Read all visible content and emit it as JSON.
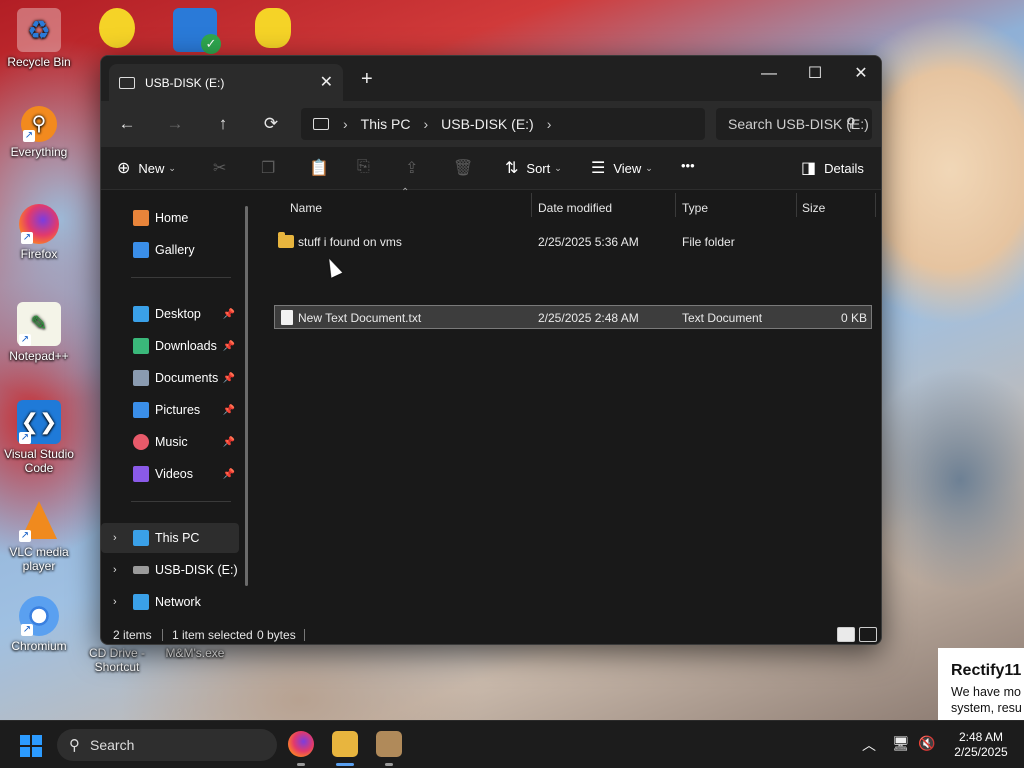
{
  "desktop": {
    "icons": [
      {
        "label": "Recycle Bin",
        "icon": "recycle-bin-icon"
      },
      {
        "label": "Everything",
        "icon": "everything-search-icon"
      },
      {
        "label": "Firefox",
        "icon": "firefox-icon"
      },
      {
        "label": "Notepad++",
        "icon": "notepadpp-icon"
      },
      {
        "label": "Visual Studio Code",
        "icon": "vscode-icon"
      },
      {
        "label": "VLC media player",
        "icon": "vlc-icon"
      },
      {
        "label": "Chromium",
        "icon": "chromium-icon"
      },
      {
        "label": "CD Drive - Shortcut",
        "icon": "cd-drive-icon"
      },
      {
        "label": "M&M's.exe",
        "icon": "exe-icon"
      }
    ]
  },
  "window": {
    "tab_title": "USB-DISK (E:)",
    "new_tab": "+",
    "controls": {
      "minimize": "—",
      "maximize": "☐",
      "close": "✕"
    }
  },
  "nav": {
    "back": "←",
    "forward": "→",
    "up": "↑",
    "refresh": "⟳",
    "breadcrumb": [
      "This PC",
      "USB-DISK (E:)"
    ],
    "search_placeholder": "Search USB-DISK (E:)"
  },
  "toolbar": {
    "new": "New",
    "sort": "Sort",
    "view": "View",
    "more": "•••",
    "details": "Details"
  },
  "sidebar": {
    "top": [
      {
        "label": "Home",
        "color": "#e8843a"
      },
      {
        "label": "Gallery",
        "color": "#3a8ee8"
      }
    ],
    "pinned": [
      {
        "label": "Desktop",
        "color": "#3aa0e8"
      },
      {
        "label": "Downloads",
        "color": "#3ab87a"
      },
      {
        "label": "Documents",
        "color": "#8a9bb0"
      },
      {
        "label": "Pictures",
        "color": "#3a8ee8"
      },
      {
        "label": "Music",
        "color": "#e85a6a"
      },
      {
        "label": "Videos",
        "color": "#8a5ae8"
      }
    ],
    "locations": [
      {
        "label": "This PC",
        "color": "#3aa0e8",
        "selected": true
      },
      {
        "label": "USB-DISK (E:)",
        "color": "#9a9a9a",
        "selected": false
      },
      {
        "label": "Network",
        "color": "#3aa0e8",
        "selected": false
      }
    ]
  },
  "columns": [
    "Name",
    "Date modified",
    "Type",
    "Size"
  ],
  "files": [
    {
      "name": "stuff i found on vms",
      "date": "2/25/2025 5:36 AM",
      "type": "File folder",
      "size": ""
    },
    {
      "name": "New Text Document.txt",
      "date": "2/25/2025 2:48 AM",
      "type": "Text Document",
      "size": "0 KB"
    }
  ],
  "status": {
    "count": "2 items",
    "selected": "1 item selected",
    "size": "0 bytes"
  },
  "taskbar": {
    "search": "Search",
    "time": "2:48 AM",
    "date": "2/25/2025"
  },
  "notification": {
    "title": "Rectify11",
    "body_line1": "We have mo",
    "body_line2": "system, resu"
  }
}
